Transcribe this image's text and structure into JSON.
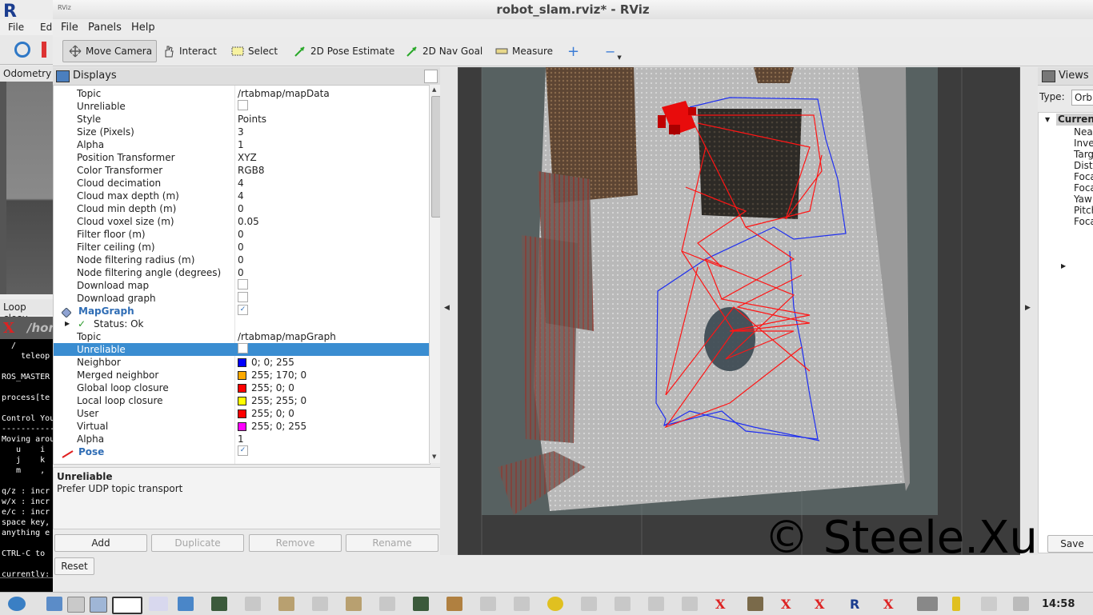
{
  "window": {
    "title": "robot_slam.rviz* - RViz",
    "icon_text": "RViz"
  },
  "menu": {
    "file": "File",
    "panels": "Panels",
    "help": "Help"
  },
  "toolbar": {
    "move_camera": "Move Camera",
    "interact": "Interact",
    "select": "Select",
    "pose_estimate": "2D Pose Estimate",
    "nav_goal": "2D Nav Goal",
    "measure": "Measure",
    "plus": "+",
    "minus": "−"
  },
  "displays": {
    "title": "Displays",
    "rows": [
      {
        "k": "Topic",
        "v": "/rtabmap/mapData"
      },
      {
        "k": "Unreliable",
        "cb": ""
      },
      {
        "k": "Style",
        "v": "Points"
      },
      {
        "k": "Size (Pixels)",
        "v": "3"
      },
      {
        "k": "Alpha",
        "v": "1"
      },
      {
        "k": "Position Transformer",
        "v": "XYZ"
      },
      {
        "k": "Color Transformer",
        "v": "RGB8"
      },
      {
        "k": "Cloud decimation",
        "v": "4"
      },
      {
        "k": "Cloud max depth (m)",
        "v": "4"
      },
      {
        "k": "Cloud min depth (m)",
        "v": "0"
      },
      {
        "k": "Cloud voxel size (m)",
        "v": "0.05"
      },
      {
        "k": "Filter floor (m)",
        "v": "0"
      },
      {
        "k": "Filter ceiling (m)",
        "v": "0"
      },
      {
        "k": "Node filtering radius (m)",
        "v": "0"
      },
      {
        "k": "Node filtering angle (degrees)",
        "v": "0"
      },
      {
        "k": "Download map",
        "cb": ""
      },
      {
        "k": "Download graph",
        "cb": ""
      },
      {
        "k": "MapGraph",
        "cb": "✓",
        "hdr": true
      },
      {
        "k": "Status: Ok",
        "status": true
      },
      {
        "k": "Topic",
        "v": "/rtabmap/mapGraph"
      },
      {
        "k": "Unreliable",
        "cb": "",
        "sel": true
      },
      {
        "k": "Neighbor",
        "v": "0; 0; 255",
        "color": "#0000ff"
      },
      {
        "k": "Merged neighbor",
        "v": "255; 170; 0",
        "color": "#ffaa00"
      },
      {
        "k": "Global loop closure",
        "v": "255; 0; 0",
        "color": "#ff0000"
      },
      {
        "k": "Local loop closure",
        "v": "255; 255; 0",
        "color": "#ffff00"
      },
      {
        "k": "User",
        "v": "255; 0; 0",
        "color": "#ff0000"
      },
      {
        "k": "Virtual",
        "v": "255; 0; 255",
        "color": "#ff00ff"
      },
      {
        "k": "Alpha",
        "v": "1"
      },
      {
        "k": "Pose",
        "cb": "✓",
        "hdr": true
      }
    ],
    "description_title": "Unreliable",
    "description_text": "Prefer UDP topic transport",
    "buttons": {
      "add": "Add",
      "duplicate": "Duplicate",
      "remove": "Remove",
      "rename": "Rename",
      "reset": "Reset"
    }
  },
  "views": {
    "title": "Views",
    "type_label": "Type:",
    "type_value": "Orb",
    "current": "Curren",
    "items": [
      "Near",
      "Inve",
      "Targ",
      "Dista",
      "Foca",
      "Foca",
      "Yaw",
      "Pitch",
      "Foca"
    ],
    "save": "Save"
  },
  "background_window": {
    "logo": "R",
    "menu_file": "File",
    "menu_edit": "Ed",
    "odometry_tab": "Odometry",
    "loop_tab": "Loop closu",
    "terminal_title": "/hon",
    "terminal_lines": [
      "  /",
      "    teleop",
      "",
      "ROS_MASTER",
      "",
      "process[te",
      "",
      "Control You",
      "-----------",
      "Moving arou",
      "   u    i",
      "   j    k",
      "   m    ,",
      "",
      "q/z : incr",
      "w/x : incr",
      "e/c : incr",
      "space key,",
      "anything e",
      "",
      "CTRL-C to",
      "",
      "currently:"
    ]
  },
  "watermark": "© Steele.Xu",
  "clock": "14:58",
  "graph_colors": {
    "neighbor": "#0000ff",
    "loop": "#ff0000"
  }
}
